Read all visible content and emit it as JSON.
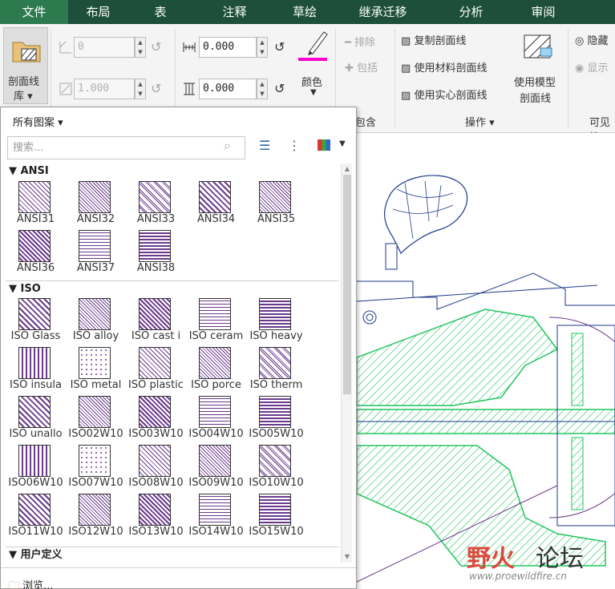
{
  "menu": {
    "tabs": [
      "文件",
      "布局",
      "表",
      "注释",
      "草绘",
      "继承迁移",
      "分析",
      "审阅"
    ]
  },
  "ribbon": {
    "hatch_lib": {
      "line1": "剖面线",
      "line2": "库"
    },
    "angle_value": "0",
    "scale_value": "1.000",
    "spacing_value": "0.000",
    "offset_value": "0.000",
    "color_label": "颜色",
    "exclude_label": "排除",
    "include_label": "包括",
    "include_group": "包含",
    "copy_hatch": "复制剖面线",
    "use_material_hatch": "使用材料剖面线",
    "use_solid_hatch": "使用实心剖面线",
    "use_model_line1": "使用模型",
    "use_model_line2": "剖面线",
    "operations_group": "操作",
    "hide_label": "隐藏",
    "show_label": "显示",
    "visible_group": "可见性"
  },
  "panel": {
    "filter_label": "所有图案",
    "search_placeholder": "搜索...",
    "sections": {
      "ansi": "ANSI",
      "iso": "ISO",
      "user": "用户定义"
    },
    "ansi_items": [
      "ANSI31",
      "ANSI32",
      "ANSI33",
      "ANSI34",
      "ANSI35",
      "ANSI36",
      "ANSI37",
      "ANSI38"
    ],
    "iso_items": [
      "ISO Glass",
      "ISO alloy",
      "ISO cast i",
      "ISO ceram",
      "ISO heavy",
      "ISO insula",
      "ISO metal",
      "ISO plastic",
      "ISO porce",
      "ISO therm",
      "ISO unallo",
      "ISO02W10",
      "ISO03W10",
      "ISO04W10",
      "ISO05W10",
      "ISO06W10",
      "ISO07W10",
      "ISO08W10",
      "ISO09W10",
      "ISO10W10",
      "ISO11W10",
      "ISO12W10",
      "ISO13W10",
      "ISO14W10",
      "ISO15W10"
    ],
    "browse_label": "浏览..."
  },
  "watermark": {
    "brand_left": "野火",
    "brand_right": "论坛",
    "url": "www.proewildfire.cn"
  },
  "colors": {
    "menubar": "#1d4f3a",
    "active_tab": "#2c7a4e",
    "hatch_purple": "#6b3a8c",
    "model_green": "#22c55e",
    "model_blue": "#1e3a8a"
  }
}
